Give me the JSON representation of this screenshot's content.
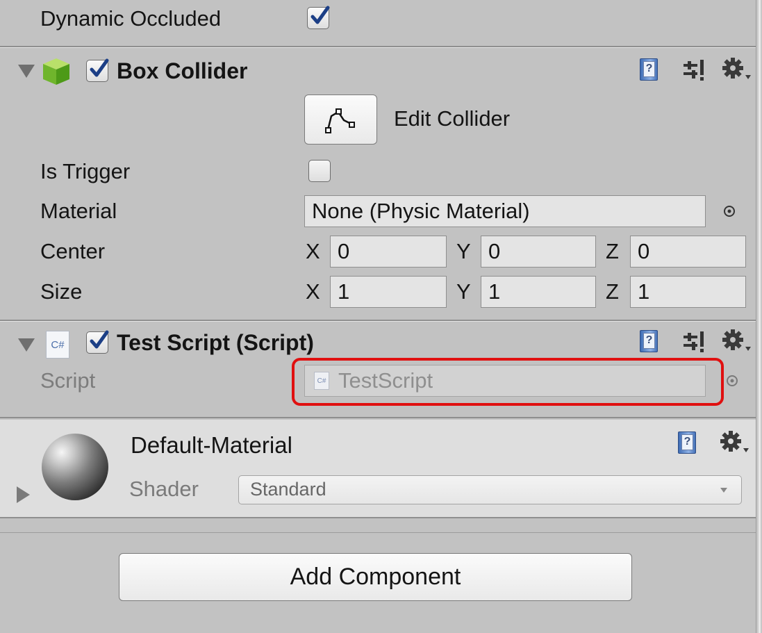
{
  "mesh_renderer": {
    "dynamic_occluded_label": "Dynamic Occluded",
    "dynamic_occluded_checked": true
  },
  "box_collider": {
    "title": "Box Collider",
    "enabled": true,
    "edit_collider_label": "Edit Collider",
    "is_trigger_label": "Is Trigger",
    "is_trigger_checked": false,
    "material_label": "Material",
    "material_value": "None (Physic Material)",
    "center_label": "Center",
    "center": {
      "x_label": "X",
      "x": "0",
      "y_label": "Y",
      "y": "0",
      "z_label": "Z",
      "z": "0"
    },
    "size_label": "Size",
    "size": {
      "x_label": "X",
      "x": "1",
      "y_label": "Y",
      "y": "1",
      "z_label": "Z",
      "z": "1"
    }
  },
  "test_script": {
    "title": "Test Script (Script)",
    "enabled": true,
    "icon_text": "C#",
    "script_label": "Script",
    "script_value": "TestScript",
    "script_icon_text": "C#"
  },
  "material": {
    "name": "Default-Material",
    "shader_label": "Shader",
    "shader_value": "Standard"
  },
  "add_component_label": "Add Component",
  "icons": {
    "help": "help-book-icon",
    "presets": "preset-sliders-icon",
    "settings": "gear-icon",
    "object_picker": "object-picker-icon",
    "collider": "green-cube-icon",
    "foldout_open": "triangle-down-icon",
    "foldout_closed": "triangle-right-icon",
    "edit_collider": "edit-collider-icon",
    "material_preview": "sphere-icon",
    "dropdown": "dropdown-arrow-icon"
  },
  "colors": {
    "highlight": "#e01010",
    "panel": "#c2c2c2",
    "checkmark": "#1c3f86"
  }
}
